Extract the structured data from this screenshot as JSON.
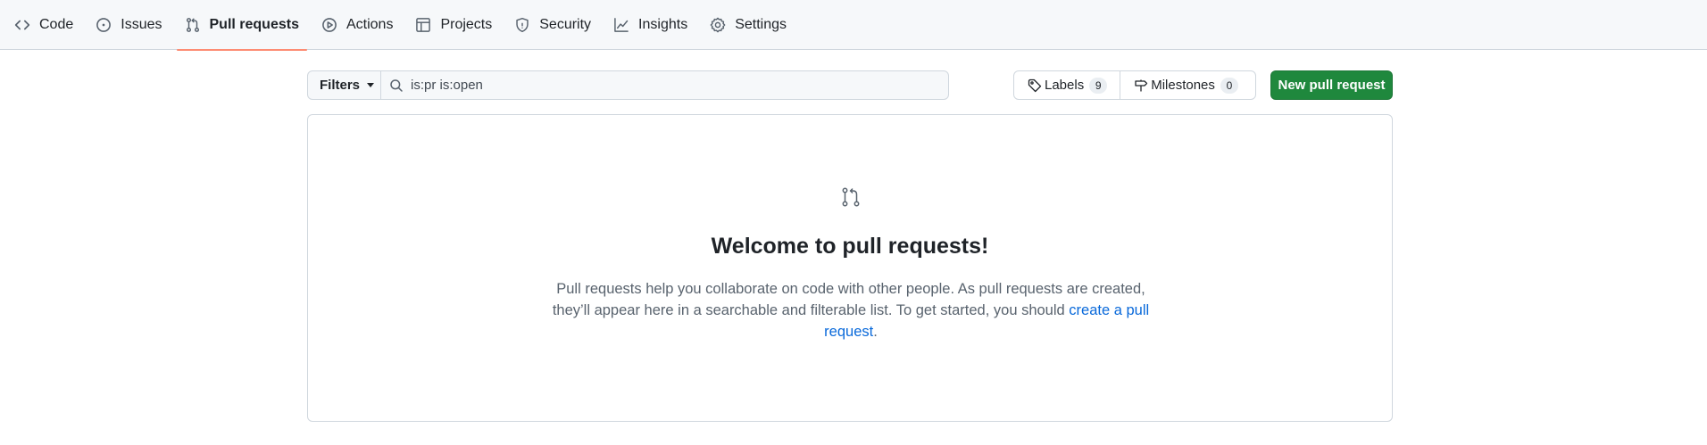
{
  "nav": {
    "items": [
      {
        "label": "Code",
        "icon": "code-icon"
      },
      {
        "label": "Issues",
        "icon": "issue-opened-icon"
      },
      {
        "label": "Pull requests",
        "icon": "git-pull-request-icon",
        "selected": true
      },
      {
        "label": "Actions",
        "icon": "play-icon"
      },
      {
        "label": "Projects",
        "icon": "table-icon"
      },
      {
        "label": "Security",
        "icon": "shield-icon"
      },
      {
        "label": "Insights",
        "icon": "graph-icon"
      },
      {
        "label": "Settings",
        "icon": "gear-icon"
      }
    ],
    "selected_underline_color": "#fd8c73"
  },
  "toolbar": {
    "filters_label": "Filters",
    "search_value": "is:pr is:open",
    "labels_label": "Labels",
    "labels_count": "9",
    "milestones_label": "Milestones",
    "milestones_count": "0",
    "new_pr_label": "New pull request",
    "new_pr_color": "#1f883d"
  },
  "blankslate": {
    "icon": "git-pull-request-icon",
    "title": "Welcome to pull requests!",
    "text": "Pull requests help you collaborate on code with other people. As pull requests are created, they’ll appear here in a searchable and filterable list. To get started, you should ",
    "link_text": "create a pull request",
    "text_end": ".",
    "link_color": "#0969da"
  }
}
